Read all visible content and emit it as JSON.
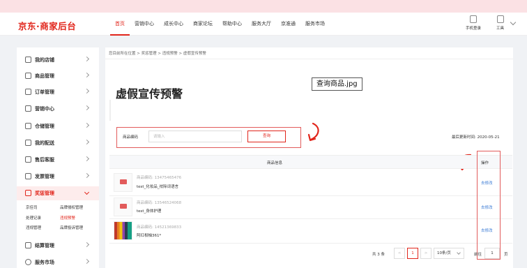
{
  "header": {
    "logo": "京东·商家后台",
    "nav": [
      "首页",
      "营销中心",
      "成长中心",
      "商家论坛",
      "帮助中心",
      "服务大厅",
      "京准通",
      "服务市场"
    ],
    "active_nav": "首页",
    "phone_label": "手机登录",
    "tools_label": "工具"
  },
  "sidebar": {
    "items": [
      {
        "label": "我的店铺",
        "icon": "store-icon"
      },
      {
        "label": "商品管理",
        "icon": "product-icon"
      },
      {
        "label": "订单管理",
        "icon": "order-icon"
      },
      {
        "label": "营销中心",
        "icon": "marketing-icon"
      },
      {
        "label": "仓储管理",
        "icon": "warehouse-icon"
      },
      {
        "label": "我的配送",
        "icon": "delivery-icon"
      },
      {
        "label": "售后客服",
        "icon": "service-icon"
      },
      {
        "label": "发票管理",
        "icon": "invoice-icon"
      },
      {
        "label": "奖惩管理",
        "icon": "reward-icon"
      },
      {
        "label": "结算管理",
        "icon": "settlement-icon"
      },
      {
        "label": "服务市场",
        "icon": "heart-icon"
      }
    ],
    "active_item": "奖惩管理",
    "submenu": [
      [
        "京佳司",
        "品牌侵权管理"
      ],
      [
        "处理记录",
        "违规预警"
      ],
      [
        "违规管理",
        "品牌投诉管理"
      ]
    ],
    "active_sub": "违规预警"
  },
  "breadcrumb": "您目前所在位置 > 奖惩管理 > 违规预警 > 虚假宣传预警",
  "page_title": "虚假宣传预警",
  "search": {
    "label": "商品编码",
    "placeholder": "请输入",
    "button": "查询"
  },
  "update_time": "最后更新时间: 2020-05-21",
  "table": {
    "col_info": "商品信息",
    "col_op": "操作",
    "rows": [
      {
        "code": "商品编码: 13475465476",
        "name": "test_化妆品_祛除词语言",
        "op": "去修改"
      },
      {
        "code": "商品编码: 13546524068",
        "name": "test_身体护理",
        "op": "去修改"
      },
      {
        "code": "商品编码: 14521369833",
        "name": "阿红柑柚361*",
        "op": "去修改"
      }
    ]
  },
  "pager": {
    "total": "共 3 条",
    "prev": "<",
    "current": "1",
    "next": ">",
    "page_size": "10条/页",
    "goto_label": "前往",
    "goto_value": "1",
    "page_unit": "页"
  },
  "tooltip": "查询商品.jpg",
  "colors": {
    "accent": "#e1251b",
    "link": "#3a7bd5",
    "annotation": "#e25b5b"
  }
}
